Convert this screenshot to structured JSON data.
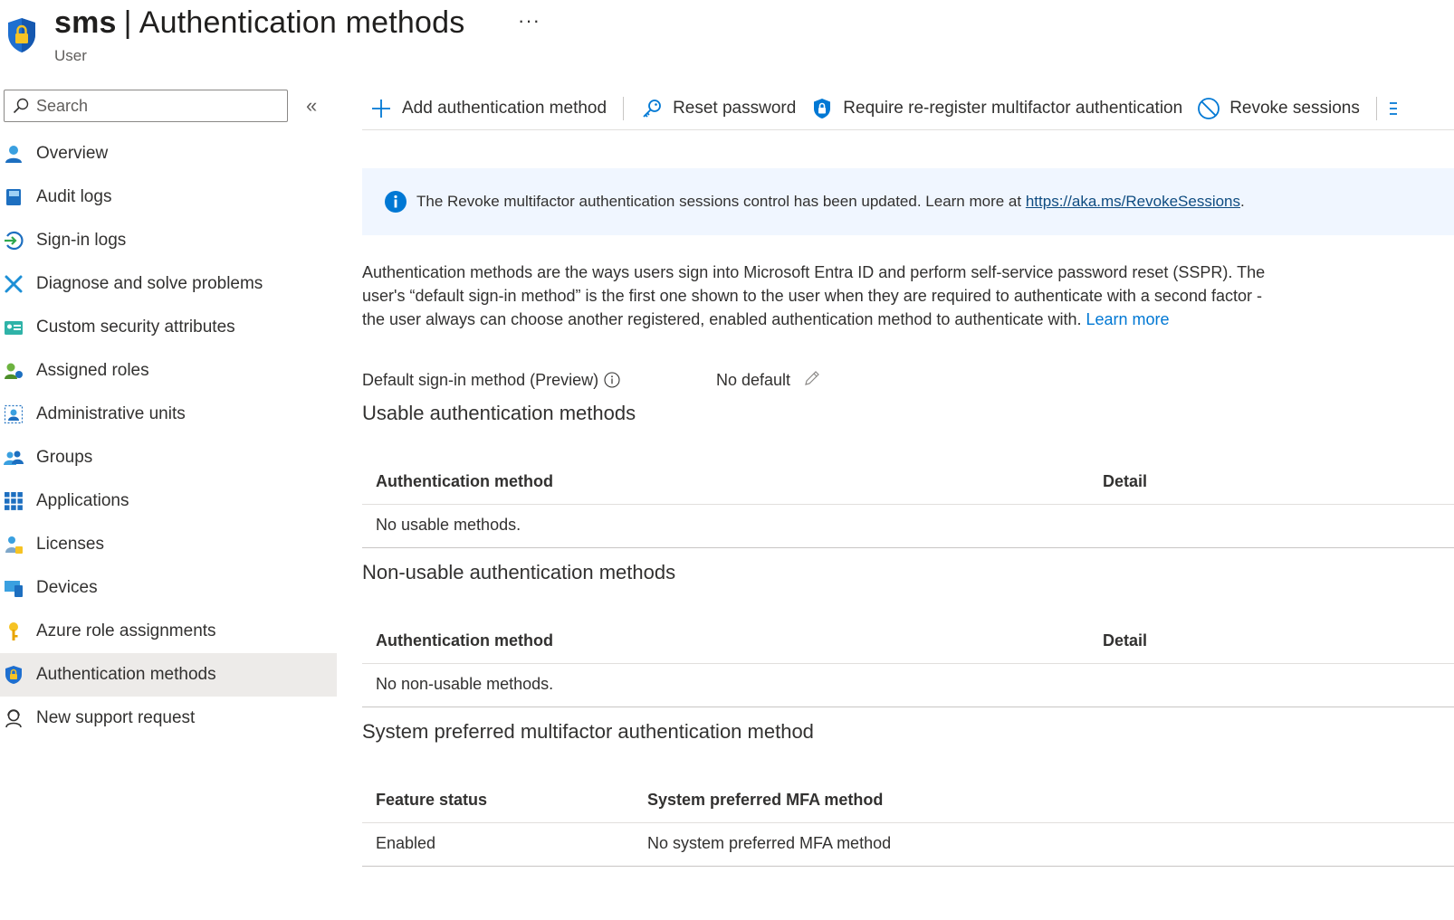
{
  "header": {
    "title_name": "sms",
    "title_separator": "|",
    "title_page": "Authentication methods",
    "more_label": "···",
    "subtitle": "User",
    "logo_icon": "shield-lock-icon"
  },
  "sidebar": {
    "search_placeholder": "Search",
    "collapse_label": "«",
    "items": [
      {
        "label": "Overview",
        "icon": "user-icon"
      },
      {
        "label": "Audit logs",
        "icon": "book-icon"
      },
      {
        "label": "Sign-in logs",
        "icon": "sign-in-icon"
      },
      {
        "label": "Diagnose and solve problems",
        "icon": "tools-icon"
      },
      {
        "label": "Custom security attributes",
        "icon": "id-card-icon"
      },
      {
        "label": "Assigned roles",
        "icon": "user-role-icon"
      },
      {
        "label": "Administrative units",
        "icon": "admin-units-icon"
      },
      {
        "label": "Groups",
        "icon": "groups-icon"
      },
      {
        "label": "Applications",
        "icon": "grid-apps-icon"
      },
      {
        "label": "Licenses",
        "icon": "license-icon"
      },
      {
        "label": "Devices",
        "icon": "devices-icon"
      },
      {
        "label": "Azure role assignments",
        "icon": "key-icon"
      },
      {
        "label": "Authentication methods",
        "icon": "shield-lock-icon",
        "active": true
      },
      {
        "label": "New support request",
        "icon": "support-icon"
      }
    ]
  },
  "toolbar": {
    "add_label": "Add authentication method",
    "reset_label": "Reset password",
    "require_label": "Require re-register multifactor authentication",
    "revoke_label": "Revoke sessions"
  },
  "banner": {
    "text": "The Revoke multifactor authentication sessions control has been updated. Learn more at ",
    "link": "https://aka.ms/RevokeSessions",
    "suffix": "."
  },
  "description": {
    "line1": "Authentication methods are the ways users sign into Microsoft Entra ID and perform self-service password reset (SSPR). The",
    "line2": "user's “default sign-in method” is the first one shown to the user when they are required to authenticate with a second factor -",
    "line3": "the user always can choose another registered, enabled authentication method to authenticate with. ",
    "learn_more": "Learn more"
  },
  "default_signin": {
    "label": "Default sign-in method (Preview)",
    "value": "No default"
  },
  "usable": {
    "title": "Usable authentication methods",
    "col1": "Authentication method",
    "col2": "Detail",
    "empty": "No usable methods."
  },
  "non_usable": {
    "title": "Non-usable authentication methods",
    "col1": "Authentication method",
    "col2": "Detail",
    "empty": "No non-usable methods."
  },
  "system_preferred": {
    "title": "System preferred multifactor authentication method",
    "col1": "Feature status",
    "col2": "System preferred MFA method",
    "status": "Enabled",
    "method": "No system preferred MFA method"
  },
  "colors": {
    "accent": "#0078d4",
    "active_bg": "#edebe9",
    "banner_bg": "#f0f6ff"
  }
}
